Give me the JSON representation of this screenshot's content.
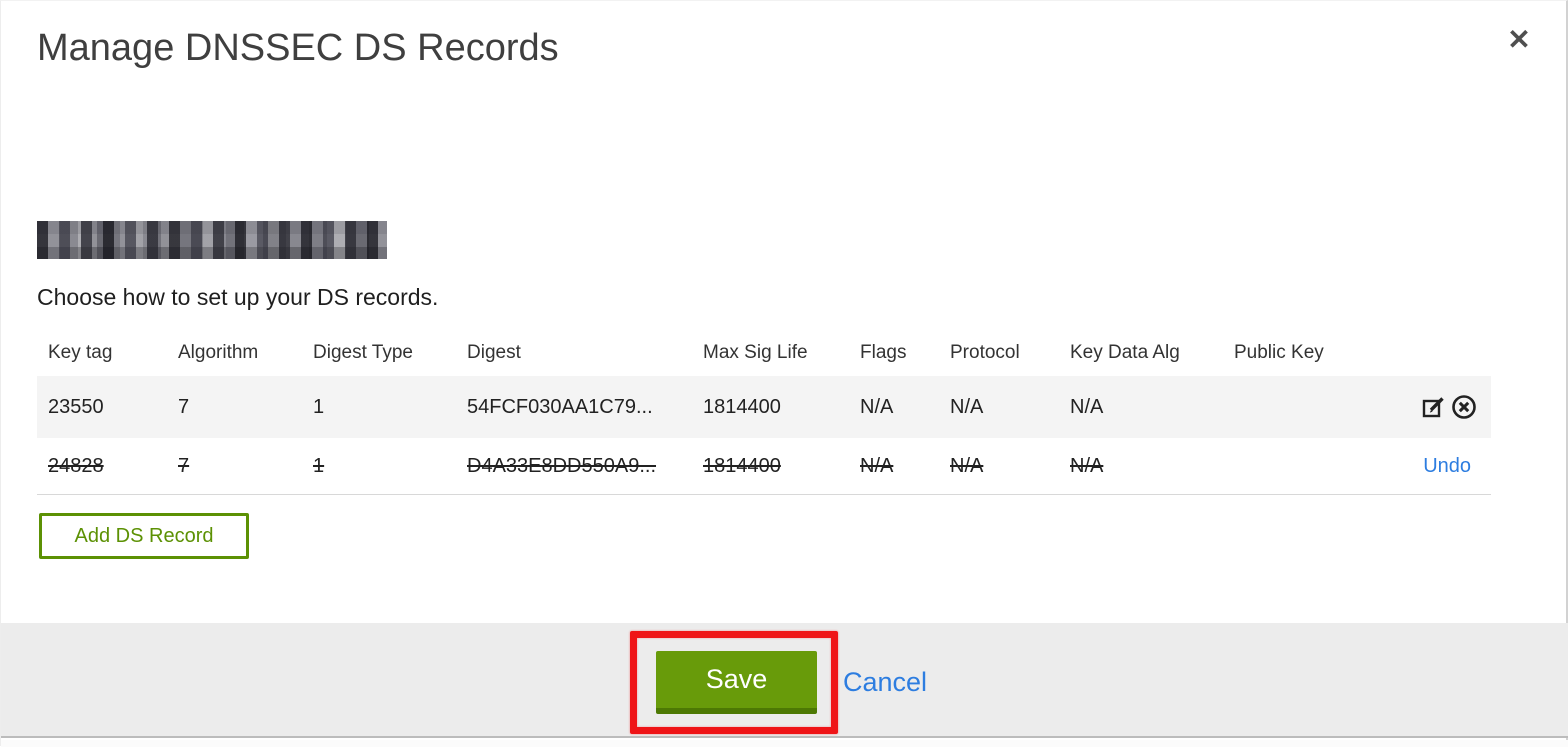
{
  "modal": {
    "title": "Manage DNSSEC DS Records",
    "close_icon": "✕",
    "instruction": "Choose how to set up your DS records."
  },
  "table": {
    "columns": [
      "Key tag",
      "Algorithm",
      "Digest Type",
      "Digest",
      "Max Sig Life",
      "Flags",
      "Protocol",
      "Key Data Alg",
      "Public Key"
    ],
    "rows": [
      {
        "cells": [
          "23550",
          "7",
          "1",
          "54FCF030AA1C79...",
          "1814400",
          "N/A",
          "N/A",
          "N/A",
          ""
        ],
        "state": "active"
      },
      {
        "cells": [
          "24828",
          "7",
          "1",
          "D4A33E8DD550A9...",
          "1814400",
          "N/A",
          "N/A",
          "N/A",
          ""
        ],
        "state": "deleted",
        "undo_label": "Undo"
      }
    ]
  },
  "buttons": {
    "add_ds_record": "Add DS Record"
  },
  "footer": {
    "save_label": "Save",
    "cancel_label": "Cancel"
  },
  "colors": {
    "accent_green": "#689b0a",
    "button_border_green": "#4d7904",
    "outline_green": "#5c9104",
    "link_blue": "#2d7de0",
    "annotation_red": "#ef1417",
    "row_stripe_gray": "#f4f4f4",
    "footer_gray": "#ececec"
  }
}
